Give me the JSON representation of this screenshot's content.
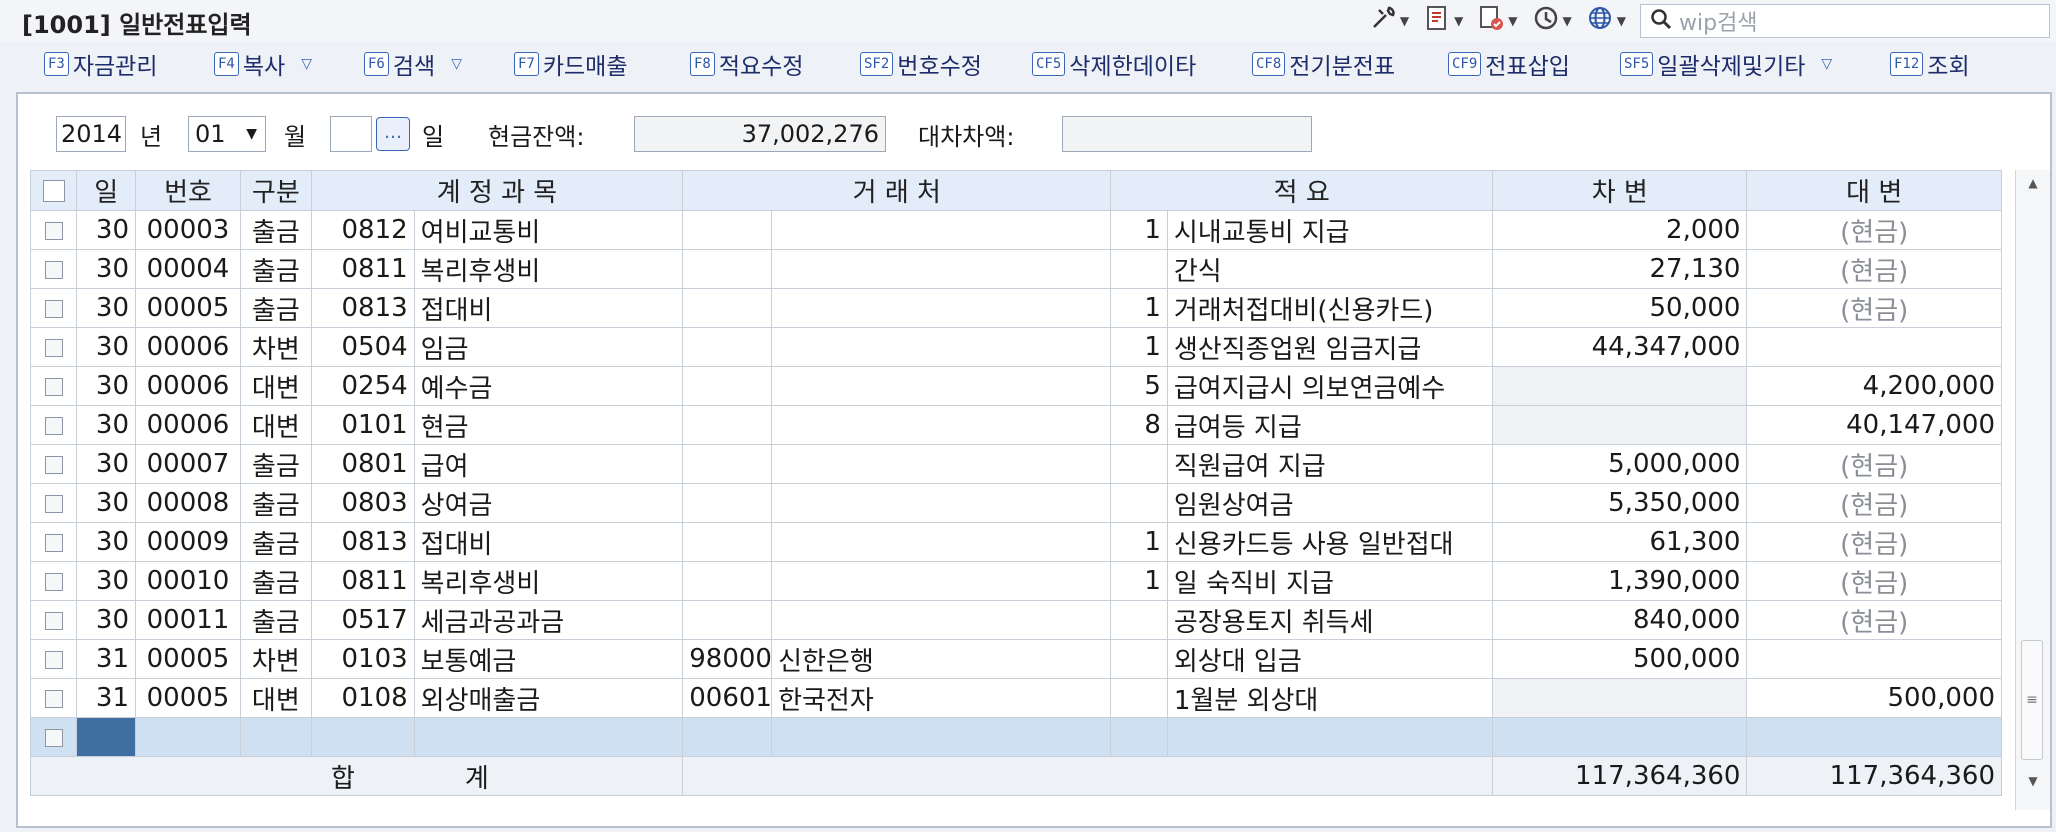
{
  "window": {
    "title": "[1001] 일반전표입력"
  },
  "toolbar": {
    "search_placeholder": "wip검색"
  },
  "fkeys": [
    {
      "key": "F3",
      "label": "자금관리",
      "drop": false
    },
    {
      "key": "F4",
      "label": "복사",
      "drop": true
    },
    {
      "key": "F6",
      "label": "검색",
      "drop": true
    },
    {
      "key": "F7",
      "label": "카드매출",
      "drop": false
    },
    {
      "key": "F8",
      "label": "적요수정",
      "drop": false
    },
    {
      "key": "SF2",
      "label": "번호수정",
      "drop": false
    },
    {
      "key": "CF5",
      "label": "삭제한데이타",
      "drop": false
    },
    {
      "key": "CF8",
      "label": "전기분전표",
      "drop": false
    },
    {
      "key": "CF9",
      "label": "전표삽입",
      "drop": false
    },
    {
      "key": "SF5",
      "label": "일괄삭제및기타",
      "drop": true
    },
    {
      "key": "F12",
      "label": "조회",
      "drop": false
    }
  ],
  "filter": {
    "year": "2014",
    "year_label": "년",
    "month": "01",
    "month_label": "월",
    "day": "",
    "day_label": "일",
    "cash_label": "현금잔액:",
    "cash_value": "37,002,276",
    "diff_label": "대차차액:",
    "diff_value": ""
  },
  "table": {
    "headers": {
      "day": "일",
      "no": "번호",
      "type": "구분",
      "account": "계 정 과 목",
      "partner": "거 래 처",
      "summary": "적 요",
      "debit": "차 변",
      "credit": "대 변"
    },
    "rows": [
      {
        "day": "30",
        "no": "00003",
        "type": "출금",
        "code": "0812",
        "name": "여비교통비",
        "pcode": "",
        "pname": "",
        "snum": "1",
        "summary": "시내교통비 지급",
        "debit": "2,000",
        "credit": "(현금)"
      },
      {
        "day": "30",
        "no": "00004",
        "type": "출금",
        "code": "0811",
        "name": "복리후생비",
        "pcode": "",
        "pname": "",
        "snum": "",
        "summary": "간식",
        "debit": "27,130",
        "credit": "(현금)"
      },
      {
        "day": "30",
        "no": "00005",
        "type": "출금",
        "code": "0813",
        "name": "접대비",
        "pcode": "",
        "pname": "",
        "snum": "1",
        "summary": "거래처접대비(신용카드)",
        "debit": "50,000",
        "credit": "(현금)"
      },
      {
        "day": "30",
        "no": "00006",
        "type": "차변",
        "code": "0504",
        "name": "임금",
        "pcode": "",
        "pname": "",
        "snum": "1",
        "summary": "생산직종업원 임금지급",
        "debit": "44,347,000",
        "credit": ""
      },
      {
        "day": "30",
        "no": "00006",
        "type": "대변",
        "code": "0254",
        "name": "예수금",
        "pcode": "",
        "pname": "",
        "snum": "5",
        "summary": "급여지급시 의보연금예수",
        "debit": "",
        "credit": "4,200,000"
      },
      {
        "day": "30",
        "no": "00006",
        "type": "대변",
        "code": "0101",
        "name": "현금",
        "pcode": "",
        "pname": "",
        "snum": "8",
        "summary": "급여등 지급",
        "debit": "",
        "credit": "40,147,000"
      },
      {
        "day": "30",
        "no": "00007",
        "type": "출금",
        "code": "0801",
        "name": "급여",
        "pcode": "",
        "pname": "",
        "snum": "",
        "summary": "직원급여 지급",
        "debit": "5,000,000",
        "credit": "(현금)"
      },
      {
        "day": "30",
        "no": "00008",
        "type": "출금",
        "code": "0803",
        "name": "상여금",
        "pcode": "",
        "pname": "",
        "snum": "",
        "summary": "임원상여금",
        "debit": "5,350,000",
        "credit": "(현금)"
      },
      {
        "day": "30",
        "no": "00009",
        "type": "출금",
        "code": "0813",
        "name": "접대비",
        "pcode": "",
        "pname": "",
        "snum": "1",
        "summary": "신용카드등 사용 일반접대",
        "debit": "61,300",
        "credit": "(현금)"
      },
      {
        "day": "30",
        "no": "00010",
        "type": "출금",
        "code": "0811",
        "name": "복리후생비",
        "pcode": "",
        "pname": "",
        "snum": "1",
        "summary": "일 숙직비 지급",
        "debit": "1,390,000",
        "credit": "(현금)"
      },
      {
        "day": "30",
        "no": "00011",
        "type": "출금",
        "code": "0517",
        "name": "세금과공과금",
        "pcode": "",
        "pname": "",
        "snum": "",
        "summary": "공장용토지 취득세",
        "debit": "840,000",
        "credit": "(현금)"
      },
      {
        "day": "31",
        "no": "00005",
        "type": "차변",
        "code": "0103",
        "name": "보통예금",
        "pcode": "98000",
        "pname": "신한은행",
        "snum": "",
        "summary": "외상대 입금",
        "debit": "500,000",
        "credit": ""
      },
      {
        "day": "31",
        "no": "00005",
        "type": "대변",
        "code": "0108",
        "name": "외상매출금",
        "pcode": "00601",
        "pname": "한국전자",
        "snum": "",
        "summary": "1월분 외상대",
        "debit": "",
        "credit": "500,000"
      }
    ],
    "total": {
      "label_1": "합",
      "label_2": "계",
      "debit": "117,364,360",
      "credit": "117,364,360"
    }
  },
  "colors": {
    "header_bg": "#e3ecf9",
    "selected_row": "#cfe0f3",
    "current_cell": "#3f6ea3",
    "fkey_border": "#3b66b8"
  }
}
